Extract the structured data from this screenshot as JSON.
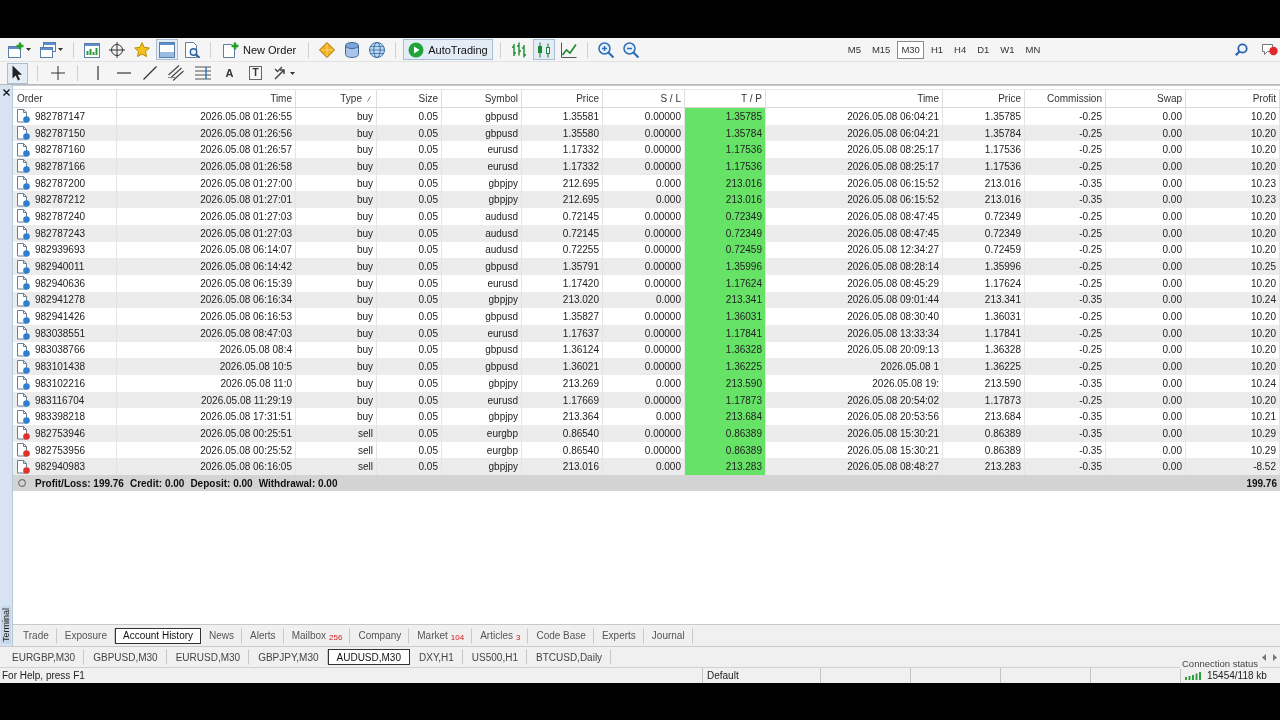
{
  "toolbar": {
    "buttons": [
      {
        "kind": "icon",
        "pressed": false
      },
      {
        "kind": "icon",
        "pressed": false
      },
      {
        "kind": "icon",
        "pressed": false
      },
      {
        "kind": "icon",
        "pressed": false
      },
      {
        "kind": "icon",
        "pressed": false
      },
      {
        "kind": "icon",
        "pressed": true
      },
      {
        "kind": "icon",
        "pressed": false
      },
      {
        "kind": "labeled",
        "label": "New Order",
        "pressed": false
      },
      {
        "kind": "icon",
        "pressed": false
      },
      {
        "kind": "icon",
        "pressed": false
      },
      {
        "kind": "icon",
        "pressed": false
      },
      {
        "kind": "labeled",
        "label": "AutoTrading",
        "pressed": true
      },
      {
        "kind": "icon",
        "pressed": false
      },
      {
        "kind": "icon",
        "pressed": true
      },
      {
        "kind": "icon",
        "pressed": false
      },
      {
        "kind": "icon",
        "pressed": false
      },
      {
        "kind": "icon",
        "pressed": false
      }
    ],
    "timeframes": [
      {
        "label": "M5",
        "selected": false
      },
      {
        "label": "M15",
        "selected": false
      },
      {
        "label": "M30",
        "selected": true
      },
      {
        "label": "H1",
        "selected": false
      },
      {
        "label": "H4",
        "selected": false
      },
      {
        "label": "D1",
        "selected": false
      },
      {
        "label": "W1",
        "selected": false
      },
      {
        "label": "MN",
        "selected": false
      }
    ]
  },
  "drawing_toolbar": {
    "buttons": [
      {
        "kind": "icon",
        "pressed": true
      },
      {
        "kind": "icon",
        "pressed": false
      },
      {
        "kind": "icon",
        "pressed": false
      },
      {
        "kind": "icon",
        "pressed": false
      },
      {
        "kind": "icon",
        "pressed": false
      },
      {
        "kind": "icon",
        "pressed": false
      },
      {
        "kind": "icon",
        "pressed": false
      },
      {
        "kind": "letter",
        "label": "A",
        "pressed": false
      },
      {
        "kind": "boxed-letter",
        "label": "T",
        "pressed": false
      },
      {
        "kind": "icon",
        "pressed": false
      }
    ]
  },
  "terminal": {
    "title": "Terminal",
    "table": {
      "columns": [
        {
          "label": "Order",
          "sorted": false
        },
        {
          "label": "Time",
          "sorted": false
        },
        {
          "label": "Type",
          "sorted": true
        },
        {
          "label": "Size",
          "sorted": false
        },
        {
          "label": "Symbol",
          "sorted": false
        },
        {
          "label": "Price",
          "sorted": false
        },
        {
          "label": "S / L",
          "sorted": false
        },
        {
          "label": "T / P",
          "sorted": false
        },
        {
          "label": "Time",
          "sorted": false
        },
        {
          "label": "Price",
          "sorted": false
        },
        {
          "label": "Commission",
          "sorted": false
        },
        {
          "label": "Swap",
          "sorted": false
        },
        {
          "label": "Profit",
          "sorted": false
        }
      ],
      "rows": [
        {
          "kind": "buy",
          "tp_hit": true,
          "cells": [
            "982787147",
            "2026.05.08 01:26:55",
            "buy",
            "0.05",
            "gbpusd",
            "1.35581",
            "0.00000",
            "1.35785",
            "2026.05.08 06:04:21",
            "1.35785",
            "-0.25",
            "0.00",
            "10.20"
          ]
        },
        {
          "kind": "buy",
          "tp_hit": true,
          "cells": [
            "982787150",
            "2026.05.08 01:26:56",
            "buy",
            "0.05",
            "gbpusd",
            "1.35580",
            "0.00000",
            "1.35784",
            "2026.05.08 06:04:21",
            "1.35784",
            "-0.25",
            "0.00",
            "10.20"
          ]
        },
        {
          "kind": "buy",
          "tp_hit": true,
          "cells": [
            "982787160",
            "2026.05.08 01:26:57",
            "buy",
            "0.05",
            "eurusd",
            "1.17332",
            "0.00000",
            "1.17536",
            "2026.05.08 08:25:17",
            "1.17536",
            "-0.25",
            "0.00",
            "10.20"
          ]
        },
        {
          "kind": "buy",
          "tp_hit": true,
          "cells": [
            "982787166",
            "2026.05.08 01:26:58",
            "buy",
            "0.05",
            "eurusd",
            "1.17332",
            "0.00000",
            "1.17536",
            "2026.05.08 08:25:17",
            "1.17536",
            "-0.25",
            "0.00",
            "10.20"
          ]
        },
        {
          "kind": "buy",
          "tp_hit": true,
          "cells": [
            "982787200",
            "2026.05.08 01:27:00",
            "buy",
            "0.05",
            "gbpjpy",
            "212.695",
            "0.000",
            "213.016",
            "2026.05.08 06:15:52",
            "213.016",
            "-0.35",
            "0.00",
            "10.23"
          ]
        },
        {
          "kind": "buy",
          "tp_hit": true,
          "cells": [
            "982787212",
            "2026.05.08 01:27:01",
            "buy",
            "0.05",
            "gbpjpy",
            "212.695",
            "0.000",
            "213.016",
            "2026.05.08 06:15:52",
            "213.016",
            "-0.35",
            "0.00",
            "10.23"
          ]
        },
        {
          "kind": "buy",
          "tp_hit": true,
          "cells": [
            "982787240",
            "2026.05.08 01:27:03",
            "buy",
            "0.05",
            "audusd",
            "0.72145",
            "0.00000",
            "0.72349",
            "2026.05.08 08:47:45",
            "0.72349",
            "-0.25",
            "0.00",
            "10.20"
          ]
        },
        {
          "kind": "buy",
          "tp_hit": true,
          "cells": [
            "982787243",
            "2026.05.08 01:27:03",
            "buy",
            "0.05",
            "audusd",
            "0.72145",
            "0.00000",
            "0.72349",
            "2026.05.08 08:47:45",
            "0.72349",
            "-0.25",
            "0.00",
            "10.20"
          ]
        },
        {
          "kind": "buy",
          "tp_hit": true,
          "cells": [
            "982939693",
            "2026.05.08 06:14:07",
            "buy",
            "0.05",
            "audusd",
            "0.72255",
            "0.00000",
            "0.72459",
            "2026.05.08 12:34:27",
            "0.72459",
            "-0.25",
            "0.00",
            "10.20"
          ]
        },
        {
          "kind": "buy",
          "tp_hit": true,
          "cells": [
            "982940011",
            "2026.05.08 06:14:42",
            "buy",
            "0.05",
            "gbpusd",
            "1.35791",
            "0.00000",
            "1.35996",
            "2026.05.08 08:28:14",
            "1.35996",
            "-0.25",
            "0.00",
            "10.25"
          ]
        },
        {
          "kind": "buy",
          "tp_hit": true,
          "cells": [
            "982940636",
            "2026.05.08 06:15:39",
            "buy",
            "0.05",
            "eurusd",
            "1.17420",
            "0.00000",
            "1.17624",
            "2026.05.08 08:45:29",
            "1.17624",
            "-0.25",
            "0.00",
            "10.20"
          ]
        },
        {
          "kind": "buy",
          "tp_hit": true,
          "cells": [
            "982941278",
            "2026.05.08 06:16:34",
            "buy",
            "0.05",
            "gbpjpy",
            "213.020",
            "0.000",
            "213.341",
            "2026.05.08 09:01:44",
            "213.341",
            "-0.35",
            "0.00",
            "10.24"
          ]
        },
        {
          "kind": "buy",
          "tp_hit": true,
          "cells": [
            "982941426",
            "2026.05.08 06:16:53",
            "buy",
            "0.05",
            "gbpusd",
            "1.35827",
            "0.00000",
            "1.36031",
            "2026.05.08 08:30:40",
            "1.36031",
            "-0.25",
            "0.00",
            "10.20"
          ]
        },
        {
          "kind": "buy",
          "tp_hit": true,
          "cells": [
            "983038551",
            "2026.05.08 08:47:03",
            "buy",
            "0.05",
            "eurusd",
            "1.17637",
            "0.00000",
            "1.17841",
            "2026.05.08 13:33:34",
            "1.17841",
            "-0.25",
            "0.00",
            "10.20"
          ]
        },
        {
          "kind": "buy",
          "tp_hit": true,
          "cells": [
            "983038766",
            "2026.05.08 08:4",
            "buy",
            "0.05",
            "gbpusd",
            "1.36124",
            "0.00000",
            "1.36328",
            "2026.05.08 20:09:13",
            "1.36328",
            "-0.25",
            "0.00",
            "10.20"
          ]
        },
        {
          "kind": "buy",
          "tp_hit": true,
          "cells": [
            "983101438",
            "2026.05.08 10:5",
            "buy",
            "0.05",
            "gbpusd",
            "1.36021",
            "0.00000",
            "1.36225",
            "2026.05.08 1",
            "1.36225",
            "-0.25",
            "0.00",
            "10.20"
          ]
        },
        {
          "kind": "buy",
          "tp_hit": true,
          "cells": [
            "983102216",
            "2026.05.08 11:0",
            "buy",
            "0.05",
            "gbpjpy",
            "213.269",
            "0.000",
            "213.590",
            "2026.05.08 19:",
            "213.590",
            "-0.35",
            "0.00",
            "10.24"
          ]
        },
        {
          "kind": "buy",
          "tp_hit": true,
          "cells": [
            "983116704",
            "2026.05.08 11:29:19",
            "buy",
            "0.05",
            "eurusd",
            "1.17669",
            "0.00000",
            "1.17873",
            "2026.05.08 20:54:02",
            "1.17873",
            "-0.25",
            "0.00",
            "10.20"
          ]
        },
        {
          "kind": "buy",
          "tp_hit": true,
          "cells": [
            "983398218",
            "2026.05.08 17:31:51",
            "buy",
            "0.05",
            "gbpjpy",
            "213.364",
            "0.000",
            "213.684",
            "2026.05.08 20:53:56",
            "213.684",
            "-0.35",
            "0.00",
            "10.21"
          ]
        },
        {
          "kind": "sell",
          "tp_hit": true,
          "cells": [
            "982753946",
            "2026.05.08 00:25:51",
            "sell",
            "0.05",
            "eurgbp",
            "0.86540",
            "0.00000",
            "0.86389",
            "2026.05.08 15:30:21",
            "0.86389",
            "-0.35",
            "0.00",
            "10.29"
          ]
        },
        {
          "kind": "sell",
          "tp_hit": true,
          "cells": [
            "982753956",
            "2026.05.08 00:25:52",
            "sell",
            "0.05",
            "eurgbp",
            "0.86540",
            "0.00000",
            "0.86389",
            "2026.05.08 15:30:21",
            "0.86389",
            "-0.35",
            "0.00",
            "10.29"
          ]
        },
        {
          "kind": "sell",
          "tp_hit": true,
          "cells": [
            "982940983",
            "2026.05.08 06:16:05",
            "sell",
            "0.05",
            "gbpjpy",
            "213.016",
            "0.000",
            "213.283",
            "2026.05.08 08:48:27",
            "213.283",
            "-0.35",
            "0.00",
            "-8.52"
          ]
        }
      ],
      "summary": {
        "items": [
          "Profit/Loss: 199.76",
          "Credit: 0.00",
          "Deposit: 0.00",
          "Withdrawal: 0.00"
        ],
        "total": "199.76"
      }
    },
    "tabs": [
      {
        "label": "Trade",
        "selected": false
      },
      {
        "label": "Exposure",
        "selected": false
      },
      {
        "label": "Account History",
        "selected": true
      },
      {
        "label": "News",
        "selected": false
      },
      {
        "label": "Alerts",
        "selected": false
      },
      {
        "label": "Mailbox",
        "count": "256",
        "selected": false
      },
      {
        "label": "Company",
        "selected": false
      },
      {
        "label": "Market",
        "count": "104",
        "selected": false
      },
      {
        "label": "Articles",
        "count": "3",
        "selected": false
      },
      {
        "label": "Code Base",
        "selected": false
      },
      {
        "label": "Experts",
        "selected": false
      },
      {
        "label": "Journal",
        "selected": false
      }
    ]
  },
  "chart_tabs": [
    {
      "label": "EURGBP,M30",
      "selected": false
    },
    {
      "label": "GBPUSD,M30",
      "selected": false
    },
    {
      "label": "EURUSD,M30",
      "selected": false
    },
    {
      "label": "GBPJPY,M30",
      "selected": false
    },
    {
      "label": "AUDUSD,M30",
      "selected": true
    },
    {
      "label": "DXY,H1",
      "selected": false
    },
    {
      "label": "US500,H1",
      "selected": false
    },
    {
      "label": "BTCUSD,Daily",
      "selected": false
    }
  ],
  "status_bar": {
    "help": "For Help, press F1",
    "profile": "Default",
    "traffic": "15454/118 kb",
    "tooltip": "Connection status"
  }
}
